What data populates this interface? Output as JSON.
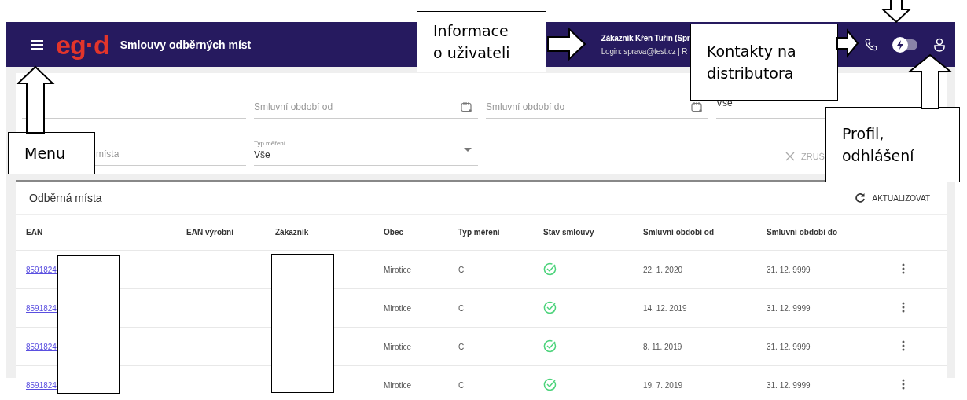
{
  "header": {
    "logo": "eg·d",
    "title": "Smlouvy odběrných míst",
    "user_name": "Zákazník Křen Tuřín (Spr",
    "user_login": "Login: sprava@test.cz | R",
    "theme_switch": {
      "on": false
    }
  },
  "filters": [
    {
      "kind": "text"
    },
    {
      "kind": "date",
      "placeholder": "Smluvní období od"
    },
    {
      "kind": "date",
      "placeholder": "Smluvní období do"
    },
    {
      "kind": "select",
      "value": "Vše"
    },
    {
      "kind": "text",
      "placeholder": "místa"
    },
    {
      "kind": "select",
      "label": "Typ měření",
      "value": "Vše"
    }
  ],
  "clear_button": "ZRUŠ",
  "table": {
    "title": "Odběrná místa",
    "refresh_button": "AKTUALIZOVAT",
    "columns": [
      "EAN",
      "EAN výrobní",
      "Zákazník",
      "Obec",
      "Typ měření",
      "Stav smlouvy",
      "Smluvní období od",
      "Smluvní období do"
    ],
    "rows": [
      {
        "ean": "8591824",
        "obec": "Mirotice",
        "typ": "C",
        "contract_active": true,
        "od": "22. 1. 2020",
        "do": "31. 12. 9999"
      },
      {
        "ean": "8591824",
        "obec": "Mirotice",
        "typ": "C",
        "contract_active": true,
        "od": "14. 12. 2019",
        "do": "31. 12. 9999"
      },
      {
        "ean": "8591824",
        "obec": "Mirotice",
        "typ": "C",
        "contract_active": true,
        "od": "8. 11. 2019",
        "do": "31. 12. 9999"
      },
      {
        "ean": "8591824",
        "obec": "Mirotice",
        "typ": "C",
        "contract_active": true,
        "od": "19. 7. 2019",
        "do": "31. 12. 9999"
      }
    ]
  },
  "callouts": [
    {
      "lines": [
        "Informace",
        "o uživateli"
      ]
    },
    {
      "lines": [
        "Kontakty na",
        "distributora"
      ]
    },
    {
      "lines": [
        "Menu"
      ]
    },
    {
      "lines": [
        "Profil,",
        "odhlášení"
      ]
    }
  ]
}
